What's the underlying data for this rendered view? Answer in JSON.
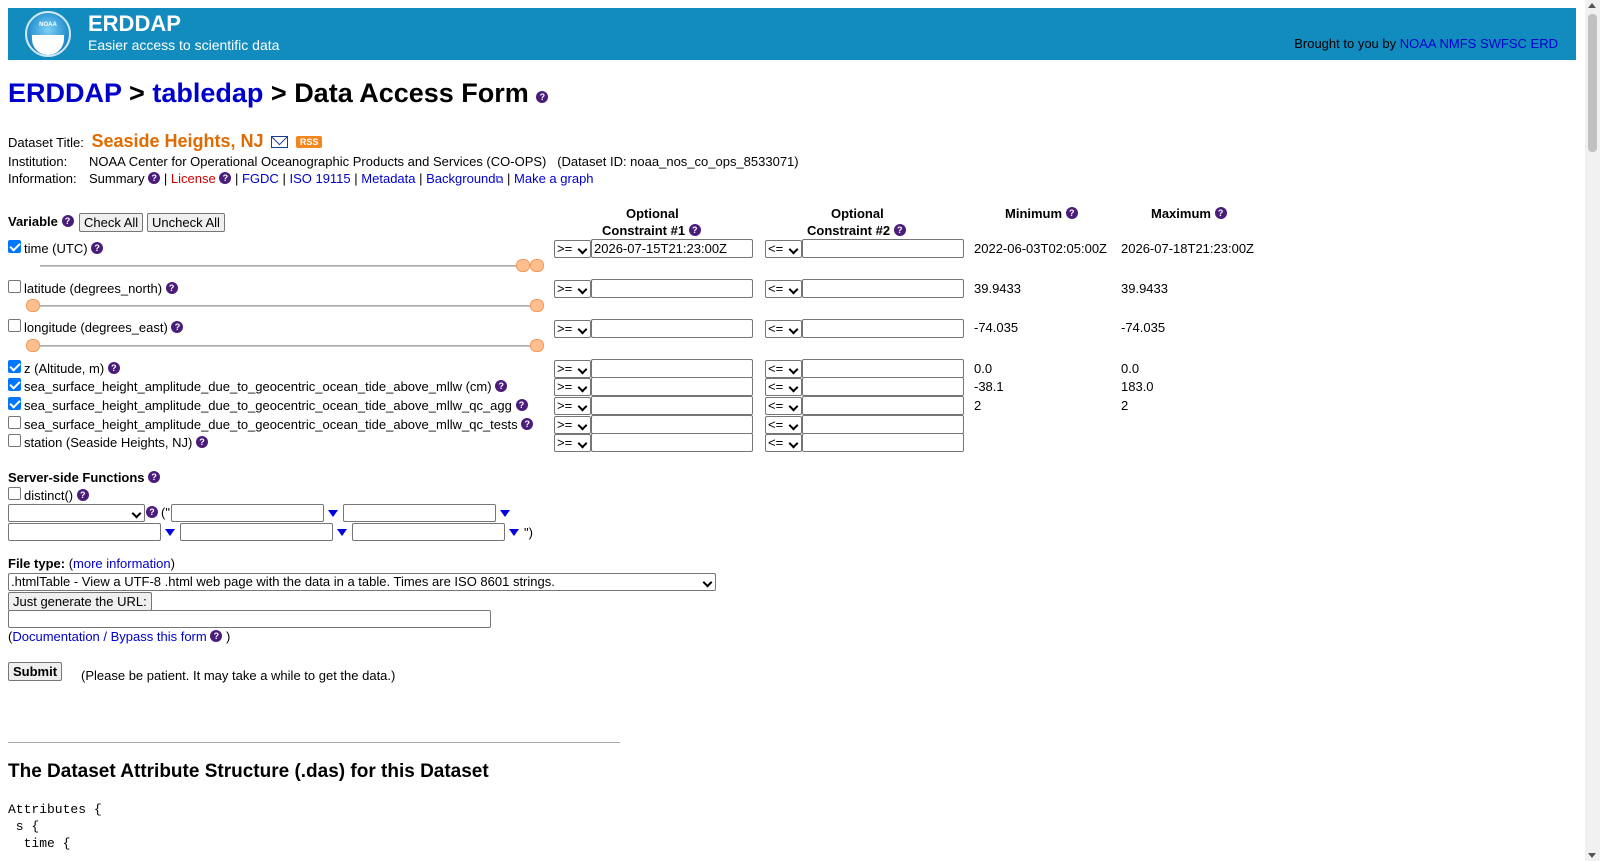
{
  "banner": {
    "title": "ERDDAP",
    "subtitle": "Easier access to scientific data",
    "logo_text": "NOAA",
    "brought_prefix": "Brought to you by",
    "brought_links": [
      "NOAA",
      "NMFS",
      "SWFSC",
      "ERD"
    ]
  },
  "breadcrumb": {
    "erddap": "ERDDAP",
    "sep": ">",
    "tabledap": "tabledap",
    "current": "Data Access Form"
  },
  "dataset": {
    "title_label": "Dataset Title:",
    "title": "Seaside Heights, NJ",
    "rss": "RSS",
    "institution_label": "Institution:",
    "institution": "NOAA Center for Operational Oceanographic Products and Services (CO-OPS)",
    "dataset_id": "(Dataset ID: noaa_nos_co_ops_8533071)",
    "information_label": "Information:",
    "links": {
      "summary": "Summary",
      "license": "License",
      "fgdc": "FGDC",
      "iso": "ISO 19115",
      "metadata": "Metadata",
      "background": "Background",
      "graph": "Make a graph"
    },
    "sep": "|"
  },
  "variables_header": {
    "variable": "Variable",
    "check_all": "Check All",
    "uncheck_all": "Uncheck All",
    "optional": "Optional",
    "constraint1": "Constraint #1",
    "constraint2": "Constraint #2",
    "minimum": "Minimum",
    "maximum": "Maximum"
  },
  "variables": [
    {
      "label": "time (UTC)",
      "checked": true,
      "op1": ">=",
      "val1": "2026-07-15T21:23:00Z",
      "op2": "<=",
      "val2": "",
      "min": "2022-06-03T02:05:00Z",
      "max": "2026-07-18T21:23:00Z"
    },
    {
      "label": "latitude (degrees_north)",
      "checked": false,
      "op1": ">=",
      "val1": "",
      "op2": "<=",
      "val2": "",
      "min": "39.9433",
      "max": "39.9433"
    },
    {
      "label": "longitude (degrees_east)",
      "checked": false,
      "op1": ">=",
      "val1": "",
      "op2": "<=",
      "val2": "",
      "min": "-74.035",
      "max": "-74.035"
    },
    {
      "label": "z (Altitude, m)",
      "checked": true,
      "op1": ">=",
      "val1": "",
      "op2": "<=",
      "val2": "",
      "min": "0.0",
      "max": "0.0"
    },
    {
      "label": "sea_surface_height_amplitude_due_to_geocentric_ocean_tide_above_mllw (cm)",
      "checked": true,
      "op1": ">=",
      "val1": "",
      "op2": "<=",
      "val2": "",
      "min": "-38.1",
      "max": "183.0"
    },
    {
      "label": "sea_surface_height_amplitude_due_to_geocentric_ocean_tide_above_mllw_qc_agg",
      "checked": true,
      "op1": ">=",
      "val1": "",
      "op2": "<=",
      "val2": "",
      "min": "2",
      "max": "2"
    },
    {
      "label": "sea_surface_height_amplitude_due_to_geocentric_ocean_tide_above_mllw_qc_tests",
      "checked": false,
      "op1": ">=",
      "val1": "",
      "op2": "<=",
      "val2": "",
      "min": "",
      "max": ""
    },
    {
      "label": "station (Seaside Heights, NJ)",
      "checked": false,
      "op1": ">=",
      "val1": "",
      "op2": "<=",
      "val2": "",
      "min": "",
      "max": ""
    }
  ],
  "server_functions": {
    "heading": "Server-side Functions",
    "distinct": "distinct()",
    "open_paren": "(\"",
    "close_paren": "\")"
  },
  "file_type": {
    "label": "File type:",
    "more_open": "(",
    "more_info": "more information",
    "more_close": ")",
    "selected": ".htmlTable - View a UTF-8 .html web page with the data in a table. Times are ISO 8601 strings.",
    "just_url": "Just generate the URL:",
    "doc_open": "(",
    "doc_link": "Documentation / Bypass this form",
    "doc_close": ")"
  },
  "submit": {
    "label": "Submit",
    "note": "(Please be patient. It may take a while to get the data.)"
  },
  "das": {
    "heading": "The Dataset Attribute Structure (.das) for this Dataset",
    "line1": "Attributes {",
    "line2": " s {",
    "line3": "  time {"
  },
  "colors": {
    "banner": "#128cbe",
    "link": "#0000cc",
    "dataset_title": "#e06b00",
    "license": "#cc0000",
    "help_icon": "#4b1d7a"
  }
}
